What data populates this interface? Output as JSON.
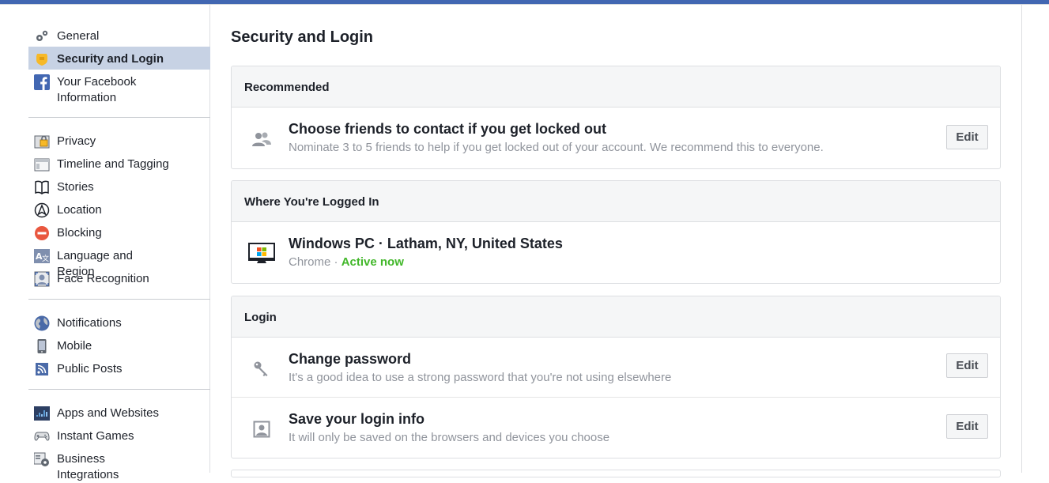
{
  "sidebar": {
    "group1": [
      {
        "label": "General",
        "icon": "gears-icon",
        "active": false
      },
      {
        "label": "Security and Login",
        "icon": "shield-badge-icon",
        "active": true
      },
      {
        "label": "Your Facebook Information",
        "icon": "facebook-icon",
        "active": false
      }
    ],
    "group2": [
      {
        "label": "Privacy",
        "icon": "lock-icon"
      },
      {
        "label": "Timeline and Tagging",
        "icon": "timeline-icon"
      },
      {
        "label": "Stories",
        "icon": "book-icon"
      },
      {
        "label": "Location",
        "icon": "location-arrow-icon"
      },
      {
        "label": "Blocking",
        "icon": "blocking-icon"
      },
      {
        "label": "Language and Region",
        "icon": "language-icon"
      },
      {
        "label": "Face Recognition",
        "icon": "face-recognition-icon"
      }
    ],
    "group3": [
      {
        "label": "Notifications",
        "icon": "globe-icon"
      },
      {
        "label": "Mobile",
        "icon": "mobile-icon"
      },
      {
        "label": "Public Posts",
        "icon": "rss-icon"
      }
    ],
    "group4": [
      {
        "label": "Apps and Websites",
        "icon": "apps-grid-icon"
      },
      {
        "label": "Instant Games",
        "icon": "gamepad-icon"
      },
      {
        "label": "Business Integrations",
        "icon": "business-gear-icon"
      }
    ]
  },
  "main": {
    "title": "Security and Login",
    "recommended": {
      "header": "Recommended",
      "title": "Choose friends to contact if you get locked out",
      "subtitle": "Nominate 3 to 5 friends to help if you get locked out of your account. We recommend this to everyone.",
      "button": "Edit"
    },
    "logged_in": {
      "header": "Where You're Logged In",
      "title": "Windows PC · Latham, NY, United States",
      "browser": "Chrome",
      "separator": " · ",
      "status": "Active now"
    },
    "login": {
      "header": "Login",
      "rows": [
        {
          "title": "Change password",
          "subtitle": "It's a good idea to use a strong password that you're not using elsewhere",
          "button": "Edit"
        },
        {
          "title": "Save your login info",
          "subtitle": "It will only be saved on the browsers and devices you choose",
          "button": "Edit"
        }
      ]
    }
  },
  "colors": {
    "brand_blue": "#4267b2",
    "active_green": "#42b72a",
    "sidebar_active_bg": "#c7d2e4"
  }
}
